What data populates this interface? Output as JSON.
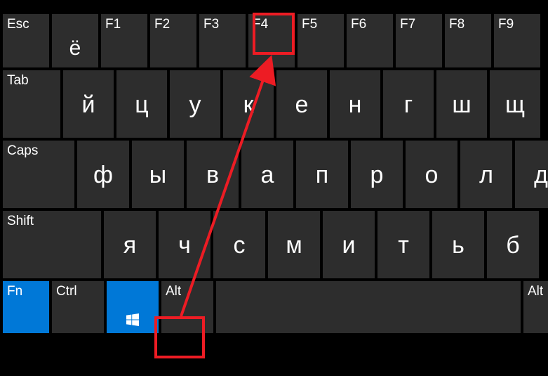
{
  "row1": {
    "esc": "Esc",
    "yo": "ё",
    "f1": "F1",
    "f2": "F2",
    "f3": "F3",
    "f4": "F4",
    "f5": "F5",
    "f6": "F6",
    "f7": "F7",
    "f8": "F8",
    "f9": "F9"
  },
  "row2": {
    "tab": "Tab",
    "k1": "й",
    "k2": "ц",
    "k3": "у",
    "k4": "к",
    "k5": "е",
    "k6": "н",
    "k7": "г",
    "k8": "ш",
    "k9": "щ"
  },
  "row3": {
    "caps": "Caps",
    "k1": "ф",
    "k2": "ы",
    "k3": "в",
    "k4": "а",
    "k5": "п",
    "k6": "р",
    "k7": "о",
    "k8": "л",
    "k9": "д"
  },
  "row4": {
    "shift": "Shift",
    "k1": "я",
    "k2": "ч",
    "k3": "с",
    "k4": "м",
    "k5": "и",
    "k6": "т",
    "k7": "ь",
    "k8": "б"
  },
  "row5": {
    "fn": "Fn",
    "ctrl": "Ctrl",
    "alt_l": "Alt",
    "alt_r": "Alt"
  },
  "annotations": {
    "highlight_f4": true,
    "highlight_alt": true,
    "arrow_from_alt_to_f4": true
  }
}
